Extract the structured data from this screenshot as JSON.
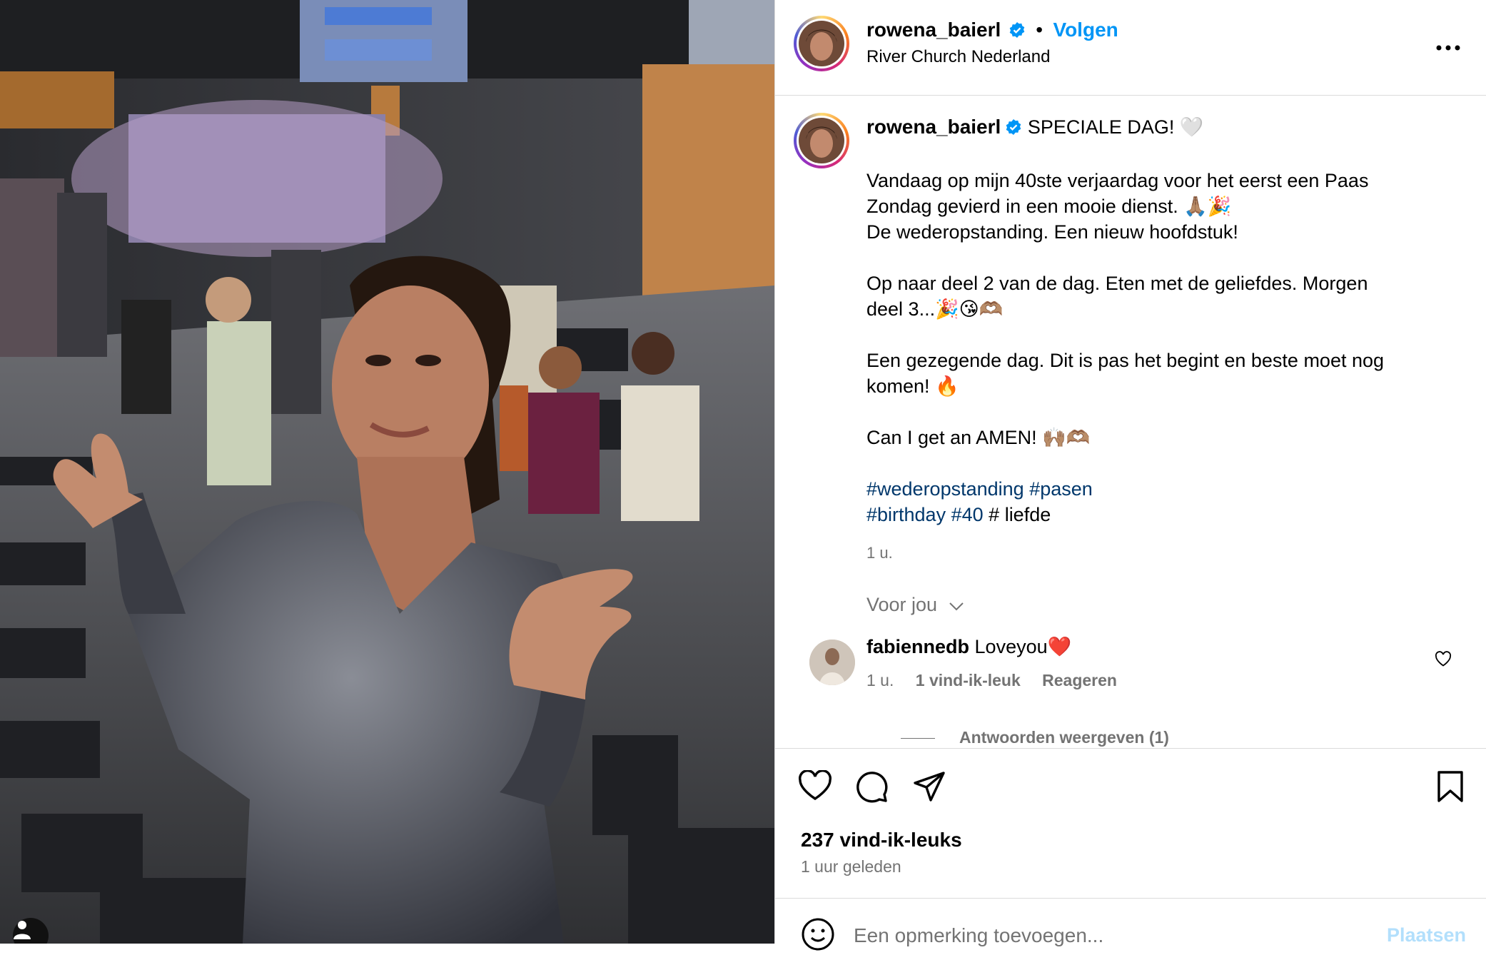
{
  "header": {
    "username": "rowena_baierl",
    "separator": "•",
    "follow_label": "Volgen",
    "location": "River Church Nederland",
    "more_icon": "more-horizontal-icon"
  },
  "caption": {
    "username": "rowena_baierl",
    "title": "SPECIALE DAG! 🤍",
    "line1": "Vandaag op mijn 40ste verjaardag voor het eerst een Paas",
    "line2": "Zondag gevierd in een mooie dienst. 🙏🏽🎉",
    "line3": "De wederopstanding. Een nieuw hoofdstuk!",
    "line4": "Op naar deel 2 van de dag. Eten met de geliefdes. Morgen",
    "line5": "deel 3...🎉😘🫶🏽",
    "line6": "Een gezegende dag. Dit is pas het begint en beste moet nog",
    "line7": "komen! 🔥",
    "line8": "Can I get an AMEN! 🙌🏽🫶🏽",
    "tags_line1": [
      "#wederopstanding",
      "#pasen"
    ],
    "tags_line2": [
      "#birthday",
      "#40"
    ],
    "tags_line2_tail": "# liefde",
    "time": "1 u."
  },
  "voor_jou": "Voor jou",
  "comment": {
    "username": "fabiennedb",
    "text": "Loveyou❤️",
    "time": "1 u.",
    "likes": "1 vind-ik-leuk",
    "reply": "Reageren",
    "view_replies": "Antwoorden weergeven (1)"
  },
  "stats": {
    "likes": "237 vind-ik-leuks",
    "posted": "1 uur geleden"
  },
  "add_comment": {
    "placeholder": "Een opmerking toevoegen...",
    "post_label": "Plaatsen"
  },
  "colors": {
    "link_blue": "#0095f6",
    "hashtag": "#00376b",
    "verified": "#0095f6",
    "secondary_text": "#737373",
    "border": "#dbdbdb"
  }
}
